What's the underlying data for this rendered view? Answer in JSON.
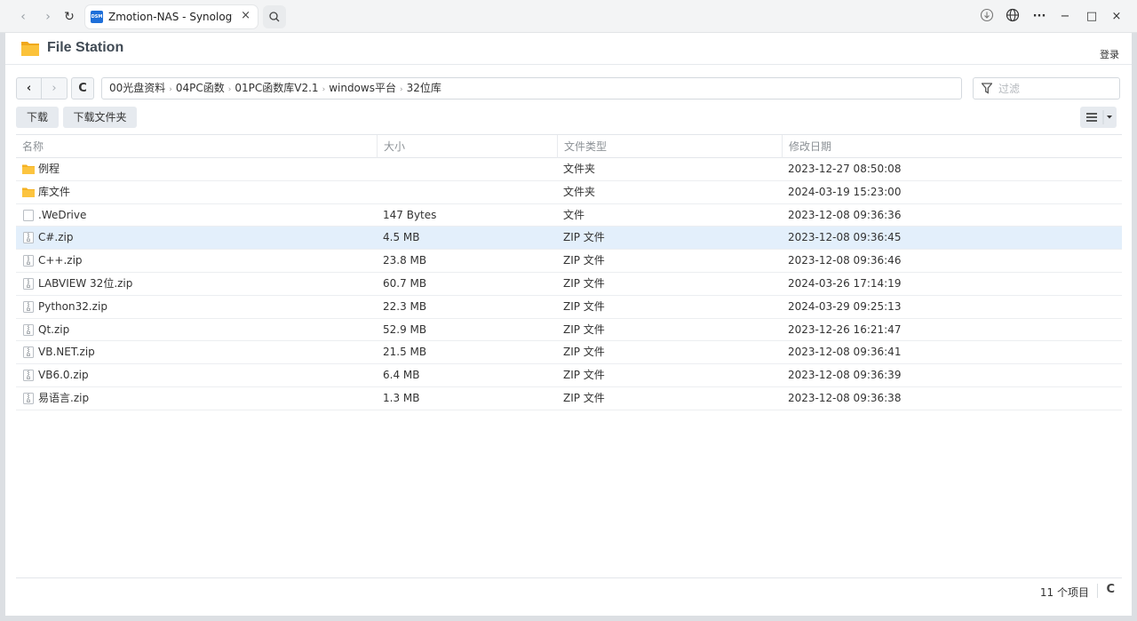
{
  "browser": {
    "tab_title": "Zmotion-NAS - Synology N",
    "favicon_text": "DSM",
    "back": "‹",
    "forward": "›",
    "reload": "↻",
    "close_tab": "×",
    "download": "⊕",
    "more": "···",
    "minimize": "−",
    "maximize": "□",
    "close": "×"
  },
  "app": {
    "title": "File Station",
    "login": "登录"
  },
  "toolbar": {
    "back": "‹",
    "forward": "›",
    "refresh": "C",
    "download": "下载",
    "download_folder": "下载文件夹",
    "filter_placeholder": "过滤"
  },
  "breadcrumb": [
    "00光盘资料",
    "04PC函数",
    "01PC函数库V2.1",
    "windows平台",
    "32位库"
  ],
  "columns": {
    "name": "名称",
    "size": "大小",
    "type": "文件类型",
    "date": "修改日期"
  },
  "files": [
    {
      "name": "例程",
      "size": "",
      "type": "文件夹",
      "date": "2023-12-27 08:50:08",
      "icon": "folder"
    },
    {
      "name": "库文件",
      "size": "",
      "type": "文件夹",
      "date": "2024-03-19 15:23:00",
      "icon": "folder"
    },
    {
      "name": ".WeDrive",
      "size": "147 Bytes",
      "type": "文件",
      "date": "2023-12-08 09:36:36",
      "icon": "file"
    },
    {
      "name": "C#.zip",
      "size": "4.5 MB",
      "type": "ZIP 文件",
      "date": "2023-12-08 09:36:45",
      "icon": "zip",
      "selected": true
    },
    {
      "name": "C++.zip",
      "size": "23.8 MB",
      "type": "ZIP 文件",
      "date": "2023-12-08 09:36:46",
      "icon": "zip"
    },
    {
      "name": "LABVIEW 32位.zip",
      "size": "60.7 MB",
      "type": "ZIP 文件",
      "date": "2024-03-26 17:14:19",
      "icon": "zip"
    },
    {
      "name": "Python32.zip",
      "size": "22.3 MB",
      "type": "ZIP 文件",
      "date": "2024-03-29 09:25:13",
      "icon": "zip"
    },
    {
      "name": "Qt.zip",
      "size": "52.9 MB",
      "type": "ZIP 文件",
      "date": "2023-12-26 16:21:47",
      "icon": "zip"
    },
    {
      "name": "VB.NET.zip",
      "size": "21.5 MB",
      "type": "ZIP 文件",
      "date": "2023-12-08 09:36:41",
      "icon": "zip"
    },
    {
      "name": "VB6.0.zip",
      "size": "6.4 MB",
      "type": "ZIP 文件",
      "date": "2023-12-08 09:36:39",
      "icon": "zip"
    },
    {
      "name": "易语言.zip",
      "size": "1.3 MB",
      "type": "ZIP 文件",
      "date": "2023-12-08 09:36:38",
      "icon": "zip"
    }
  ],
  "footer": {
    "count": "11 个项目",
    "refresh": "C"
  }
}
